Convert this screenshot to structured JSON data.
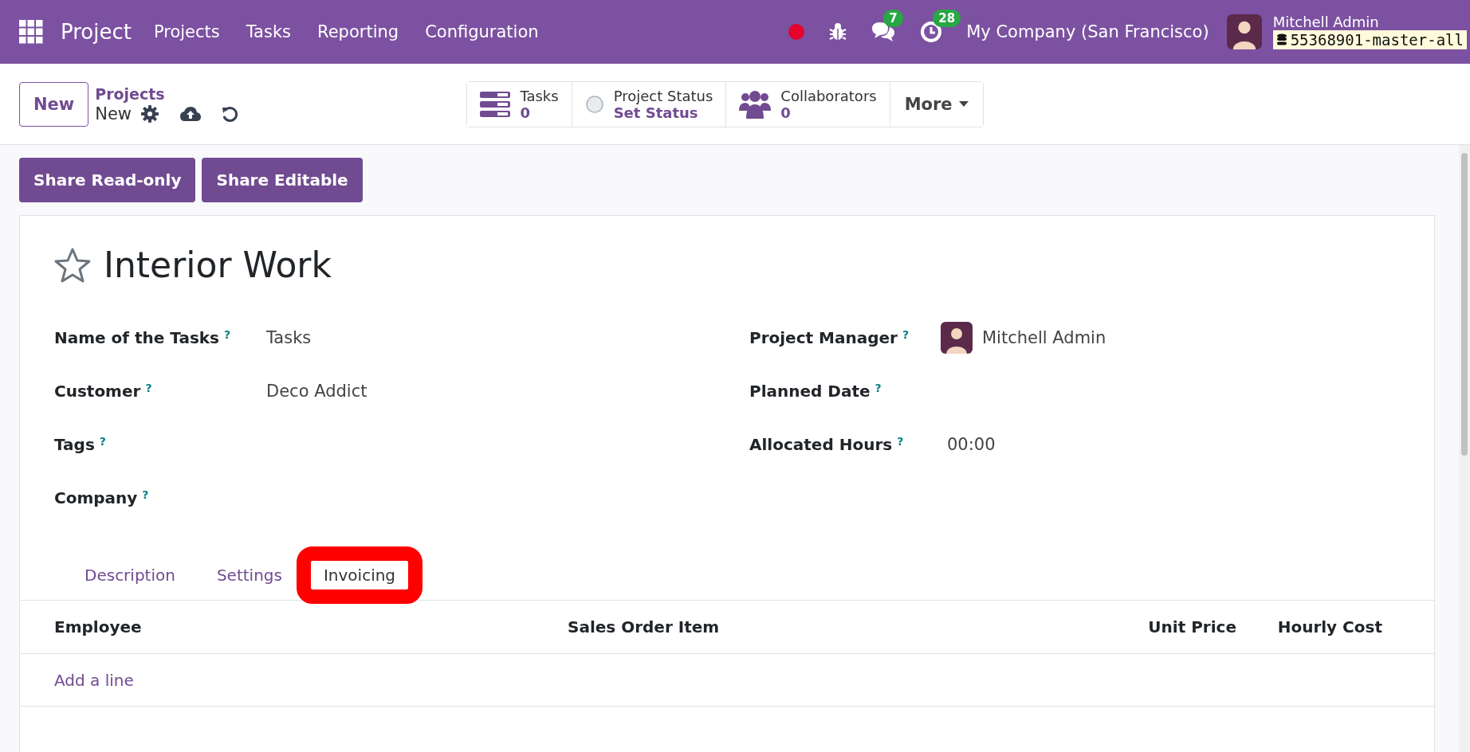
{
  "navbar": {
    "app_name": "Project",
    "menu": [
      "Projects",
      "Tasks",
      "Reporting",
      "Configuration"
    ],
    "messages_count": "7",
    "activities_count": "28",
    "company": "My Company (San Francisco)",
    "user_name": "Mitchell Admin",
    "database": "55368901-master-all"
  },
  "control_panel": {
    "new_button": "New",
    "breadcrumb_parent": "Projects",
    "breadcrumb_current": "New",
    "smart_buttons": [
      {
        "kind": "tasks",
        "label": "Tasks",
        "value": "0"
      },
      {
        "kind": "status",
        "label": "Project Status",
        "value": "Set Status"
      },
      {
        "kind": "people",
        "label": "Collaborators",
        "value": "0"
      }
    ],
    "more_button": "More"
  },
  "share_buttons": [
    "Share Read-only",
    "Share Editable"
  ],
  "form": {
    "title": "Interior Work",
    "starred": false,
    "left_fields": [
      {
        "label": "Name of the Tasks",
        "help": "?",
        "value": "Tasks"
      },
      {
        "label": "Customer",
        "help": "?",
        "value": "Deco Addict"
      },
      {
        "label": "Tags",
        "help": "?"
      },
      {
        "label": "Company",
        "help": "?"
      }
    ],
    "right_fields": [
      {
        "label": "Project Manager",
        "help": "?",
        "value": "Mitchell Admin",
        "kind": "user"
      },
      {
        "label": "Planned Date",
        "help": "?"
      },
      {
        "label": "Allocated Hours",
        "help": "?",
        "value": "00:00",
        "kind": "text"
      }
    ]
  },
  "tabs": [
    {
      "label": "Description",
      "selected": false,
      "highlighted": false
    },
    {
      "label": "Settings",
      "selected": false,
      "highlighted": false
    },
    {
      "label": "Invoicing",
      "selected": true,
      "highlighted": true
    }
  ],
  "table": {
    "columns": [
      "Employee",
      "Sales Order Item",
      "Unit Price",
      "Hourly Cost"
    ],
    "add_line": "Add a line"
  }
}
